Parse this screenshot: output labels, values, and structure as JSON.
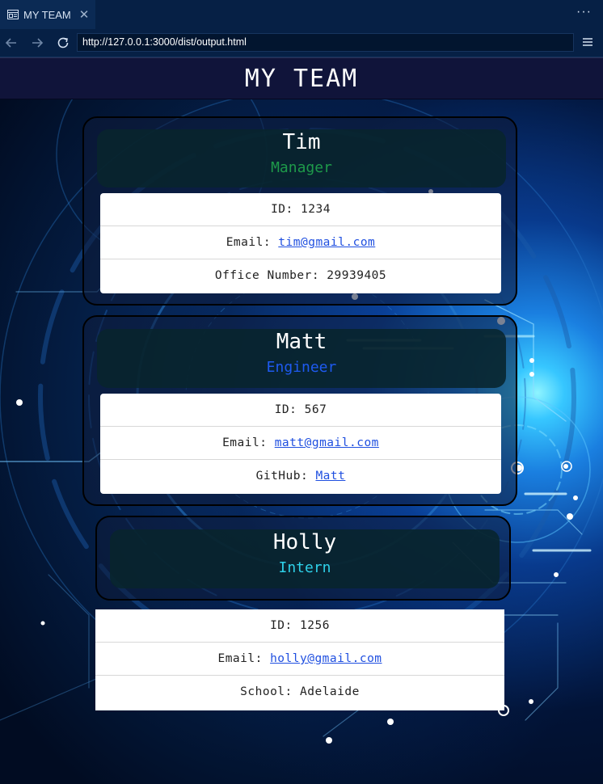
{
  "tab": {
    "title": "MY TEAM"
  },
  "address_bar": {
    "url": "http://127.0.0.1:3000/dist/output.html"
  },
  "header": {
    "title": "MY TEAM"
  },
  "colors": {
    "manager": "#1e9a4a",
    "engineer": "#1e5af0",
    "intern": "#2ed0e8",
    "link": "#1f4fe0"
  },
  "cards": [
    {
      "name": "Tim",
      "role": "Manager",
      "id_label": "ID: ",
      "id": "1234",
      "email_label": "Email: ",
      "email": "tim@gmail.com",
      "extra_label": "Office Number: ",
      "extra": "29939405"
    },
    {
      "name": "Matt",
      "role": "Engineer",
      "id_label": "ID: ",
      "id": "567",
      "email_label": "Email: ",
      "email": "matt@gmail.com",
      "extra_label": "GitHub: ",
      "extra": "Matt"
    },
    {
      "name": "Holly",
      "role": "Intern",
      "id_label": "ID: ",
      "id": "1256",
      "email_label": "Email: ",
      "email": "holly@gmail.com",
      "extra_label": "School: ",
      "extra": "Adelaide"
    }
  ]
}
